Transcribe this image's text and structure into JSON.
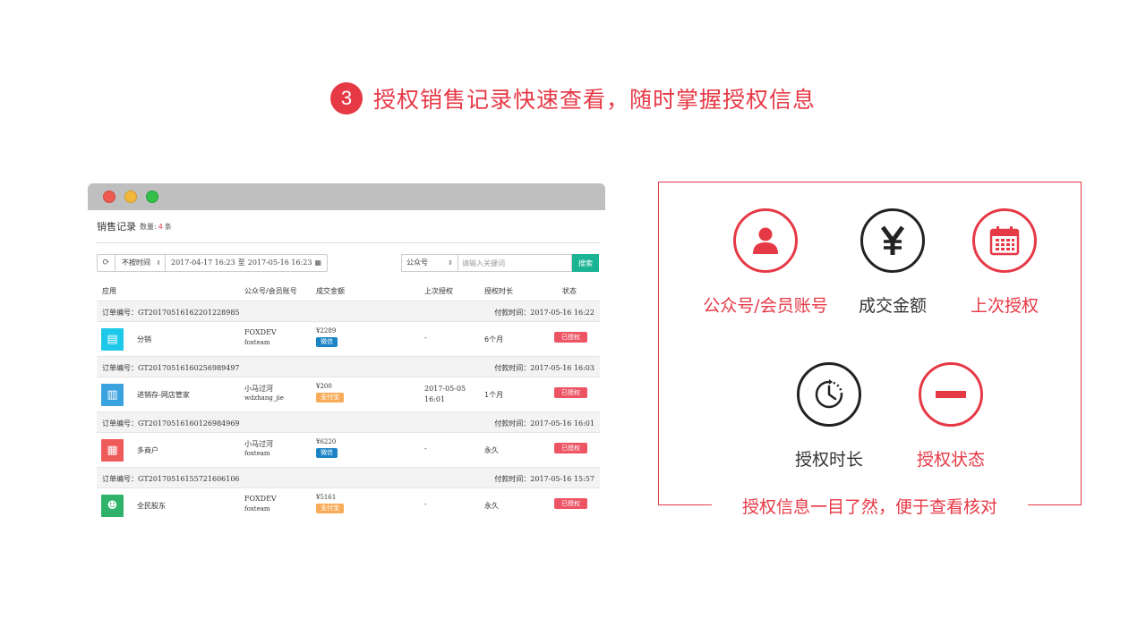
{
  "heading": {
    "step": "3",
    "title": "授权销售记录快速查看，随时掌握授权信息"
  },
  "sales": {
    "title": "销售记录",
    "count_label": "数量:",
    "count_value": "4",
    "count_unit": "条",
    "filter": {
      "time_select": "不按时间",
      "date_start": "2017-04-17 16:23",
      "date_sep": "至",
      "date_end": "2017-05-16 16:23",
      "account_select": "公众号",
      "search_placeholder": "请输入关键词",
      "search_button": "搜索"
    },
    "columns": {
      "app": "应用",
      "account": "公众号/会员账号",
      "amount": "成交金额",
      "last_auth": "上次授权",
      "duration": "授权时长",
      "status": "状态"
    },
    "orders": [
      {
        "order_no": "订单编号：GT20170516162201228985",
        "pay_time": "付款时间：2017-05-16 16:22",
        "icon": "distribution-icon",
        "icon_color": "#1ec8e8",
        "app": "分销",
        "account_name": "FOXDEV",
        "account_id": "foxteam",
        "amount": "¥2289",
        "pay_method": "微信",
        "last_auth_1": "-",
        "last_auth_2": "",
        "duration": "6个月",
        "status": "已授权"
      },
      {
        "order_no": "订单编号：GT20170516160256989497",
        "pay_time": "付款时间：2017-05-16 16:03",
        "icon": "warehouse-icon",
        "icon_color": "#3ba2e0",
        "app": "进销存-网店管家",
        "account_name": "小马过河",
        "account_id": "wdzhang_jie",
        "amount": "¥200",
        "pay_method": "支付宝",
        "last_auth_1": "2017-05-05",
        "last_auth_2": "16:01",
        "duration": "1个月",
        "status": "已授权"
      },
      {
        "order_no": "订单编号：GT20170516160126984969",
        "pay_time": "付款时间：2017-05-16 16:01",
        "icon": "multi-store-icon",
        "icon_color": "#ef5a5a",
        "app": "多商户",
        "account_name": "小马过河",
        "account_id": "foxteam",
        "amount": "¥6220",
        "pay_method": "微信",
        "last_auth_1": "-",
        "last_auth_2": "",
        "duration": "永久",
        "status": "已授权"
      },
      {
        "order_no": "订单编号：GT20170516155721606106",
        "pay_time": "付款时间：2017-05-16 15:57",
        "icon": "shareholder-icon",
        "icon_color": "#2fb36b",
        "app": "全民股东",
        "account_name": "FOXDEV",
        "account_id": "foxteam",
        "amount": "¥5161",
        "pay_method": "支付宝",
        "last_auth_1": "-",
        "last_auth_2": "",
        "duration": "永久",
        "status": "已授权"
      }
    ]
  },
  "features": {
    "account": "公众号/会员账号",
    "amount": "成交金额",
    "last_auth": "上次授权",
    "duration": "授权时长",
    "status": "授权状态",
    "footer": "授权信息一目了然，便于查看核对"
  },
  "colors": {
    "accent": "#e63946",
    "search_button": "#1ab394",
    "wechat": "#1c84c6",
    "alipay": "#f8ac59",
    "status": "#ed5565"
  }
}
